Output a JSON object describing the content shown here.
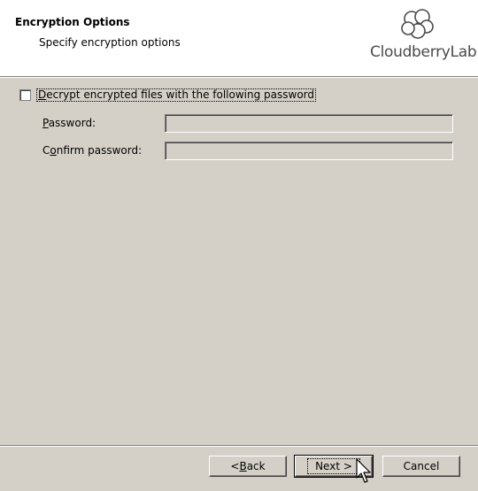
{
  "header": {
    "title": "Encryption Options",
    "subtitle": "Specify encryption options",
    "logo_text": "CloudberryLab",
    "logo_icon": "cloud-icon"
  },
  "options": {
    "decrypt_checkbox": {
      "accel": "D",
      "label_rest": "ecrypt encrypted files with the following password",
      "checked": false
    },
    "password": {
      "accel": "P",
      "label_rest": "assword:",
      "value": ""
    },
    "confirm_password": {
      "pre": "C",
      "accel": "o",
      "label_rest": "nfirm password:",
      "value": ""
    }
  },
  "buttons": {
    "back": {
      "prefix": "< ",
      "accel": "B",
      "rest": "ack"
    },
    "next": {
      "text": "Next >"
    },
    "cancel": {
      "text": "Cancel"
    }
  }
}
